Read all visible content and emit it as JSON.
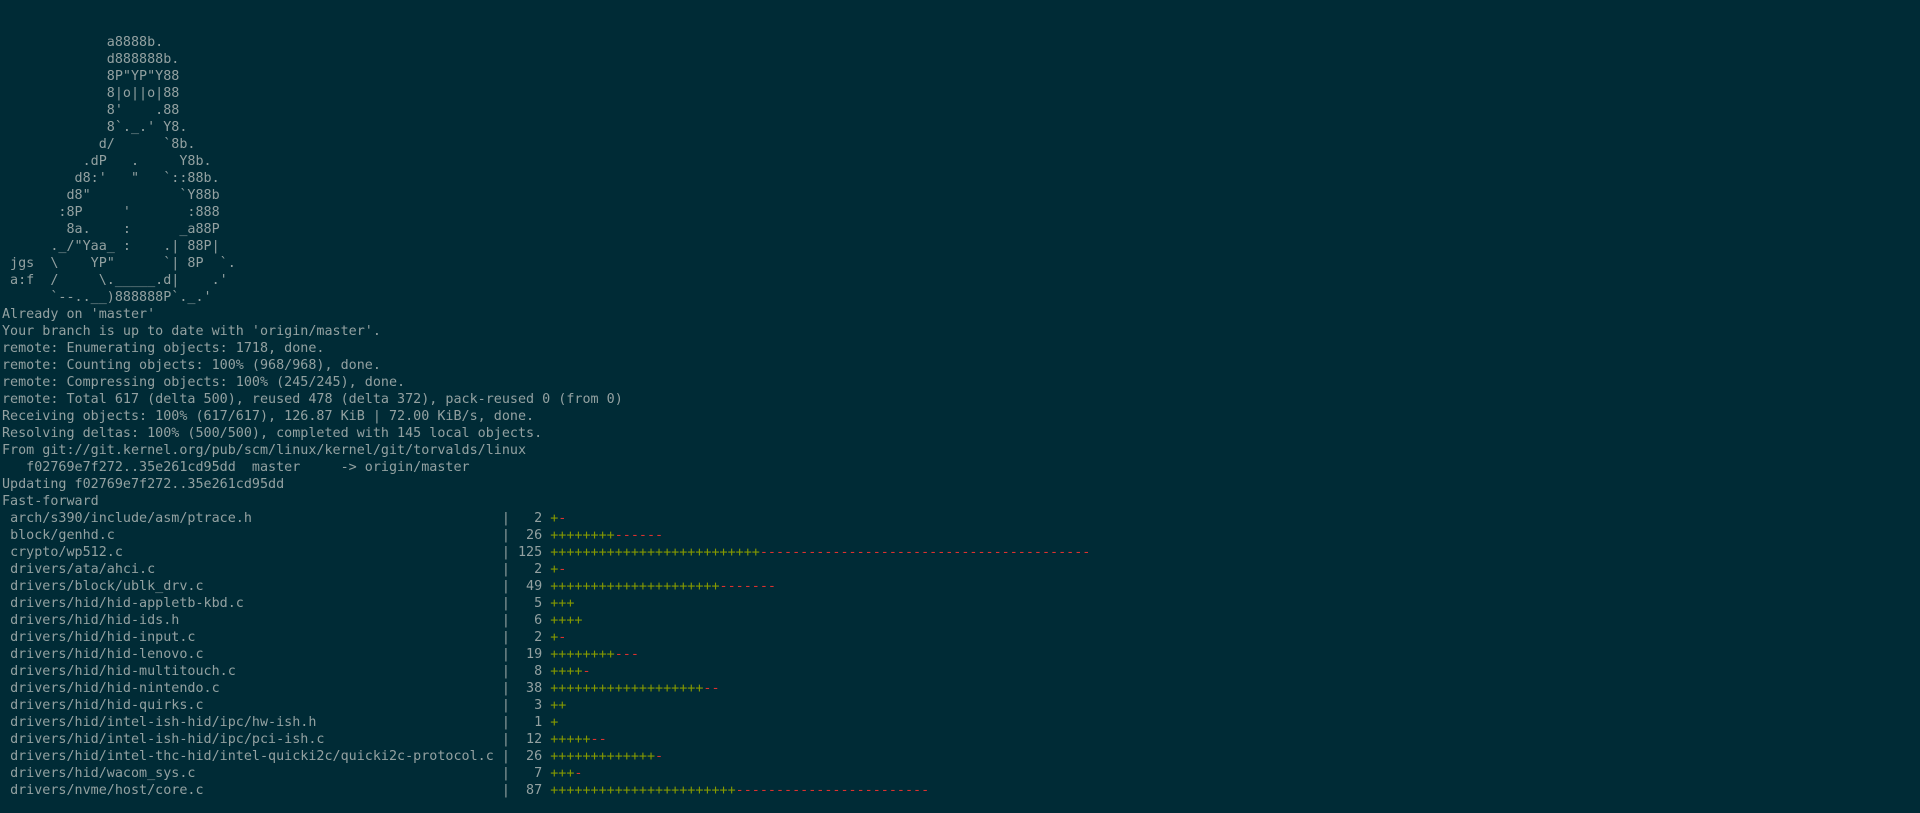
{
  "theme": {
    "background": "#002b36",
    "foreground": "#93a1a1",
    "plus_color": "#859900",
    "minus_color": "#dc322f"
  },
  "ascii_art": [
    "             a8888b.",
    "             d888888b.",
    "             8P\"YP\"Y88",
    "             8|o||o|88",
    "             8'    .88",
    "             8`._.' Y8.",
    "            d/      `8b.",
    "          .dP   .     Y8b.",
    "         d8:'   \"   `::88b.",
    "        d8\"           `Y88b",
    "       :8P     '       :888",
    "        8a.    :      _a88P",
    "      ._/\"Yaa_ :    .| 88P|",
    " jgs  \\    YP\"      `| 8P  `.",
    " a:f  /     \\._____.d|    .'",
    "      `--..__)888888P`._.'"
  ],
  "git_output": [
    "Already on 'master'",
    "Your branch is up to date with 'origin/master'.",
    "remote: Enumerating objects: 1718, done.",
    "remote: Counting objects: 100% (968/968), done.",
    "remote: Compressing objects: 100% (245/245), done.",
    "remote: Total 617 (delta 500), reused 478 (delta 372), pack-reused 0 (from 0)",
    "Receiving objects: 100% (617/617), 126.87 KiB | 72.00 KiB/s, done.",
    "Resolving deltas: 100% (500/500), completed with 145 local objects.",
    "From git://git.kernel.org/pub/scm/linux/kernel/git/torvalds/linux",
    "   f02769e7f272..35e261cd95dd  master     -> origin/master",
    "Updating f02769e7f272..35e261cd95dd",
    "Fast-forward"
  ],
  "diffstat": [
    {
      "path": "arch/s390/include/asm/ptrace.h",
      "count": "2",
      "plus": "+",
      "minus": "-"
    },
    {
      "path": "block/genhd.c",
      "count": "26",
      "plus": "++++++++",
      "minus": "------"
    },
    {
      "path": "crypto/wp512.c",
      "count": "125",
      "plus": "++++++++++++++++++++++++++",
      "minus": "-----------------------------------------"
    },
    {
      "path": "drivers/ata/ahci.c",
      "count": "2",
      "plus": "+",
      "minus": "-"
    },
    {
      "path": "drivers/block/ublk_drv.c",
      "count": "49",
      "plus": "+++++++++++++++++++++",
      "minus": "-------"
    },
    {
      "path": "drivers/hid/hid-appletb-kbd.c",
      "count": "5",
      "plus": "+++",
      "minus": ""
    },
    {
      "path": "drivers/hid/hid-ids.h",
      "count": "6",
      "plus": "++++",
      "minus": ""
    },
    {
      "path": "drivers/hid/hid-input.c",
      "count": "2",
      "plus": "+",
      "minus": "-"
    },
    {
      "path": "drivers/hid/hid-lenovo.c",
      "count": "19",
      "plus": "++++++++",
      "minus": "---"
    },
    {
      "path": "drivers/hid/hid-multitouch.c",
      "count": "8",
      "plus": "++++",
      "minus": "-"
    },
    {
      "path": "drivers/hid/hid-nintendo.c",
      "count": "38",
      "plus": "+++++++++++++++++++",
      "minus": "--"
    },
    {
      "path": "drivers/hid/hid-quirks.c",
      "count": "3",
      "plus": "++",
      "minus": ""
    },
    {
      "path": "drivers/hid/intel-ish-hid/ipc/hw-ish.h",
      "count": "1",
      "plus": "+",
      "minus": ""
    },
    {
      "path": "drivers/hid/intel-ish-hid/ipc/pci-ish.c",
      "count": "12",
      "plus": "+++++",
      "minus": "--"
    },
    {
      "path": "drivers/hid/intel-thc-hid/intel-quicki2c/quicki2c-protocol.c",
      "count": "26",
      "plus": "+++++++++++++",
      "minus": "-"
    },
    {
      "path": "drivers/hid/wacom_sys.c",
      "count": "7",
      "plus": "+++",
      "minus": "-"
    },
    {
      "path": "drivers/nvme/host/core.c",
      "count": "87",
      "plus": "+++++++++++++++++++++++",
      "minus": "------------------------"
    }
  ]
}
